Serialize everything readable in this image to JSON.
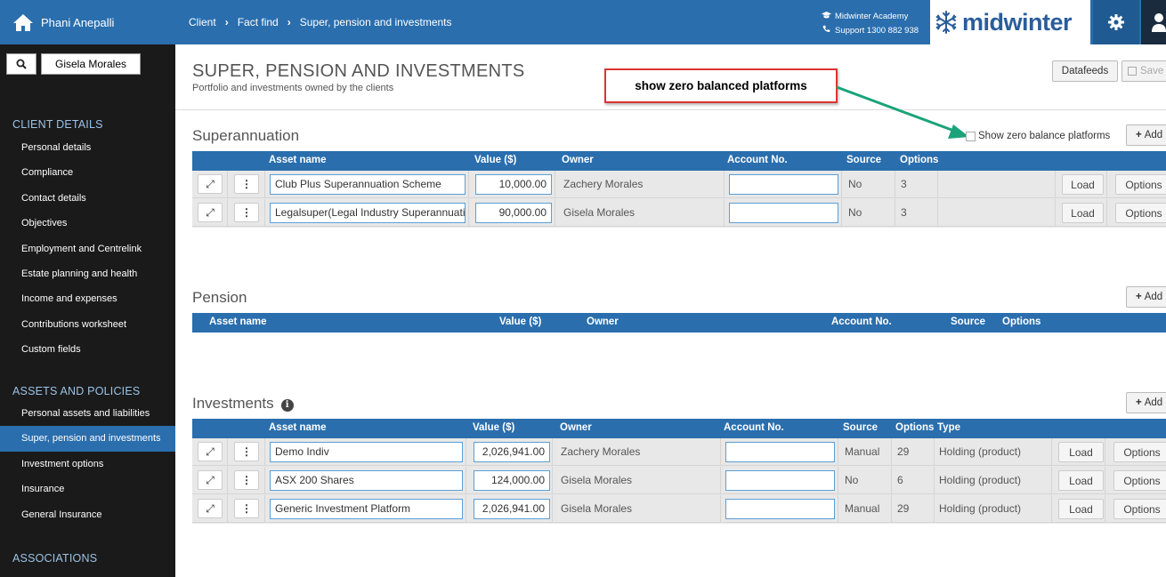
{
  "user": {
    "name": "Phani Anepalli"
  },
  "client_search": {
    "value": "Gisela Morales"
  },
  "sidebar": {
    "sections": [
      {
        "title": "CLIENT DETAILS",
        "items": [
          {
            "label": "Personal details"
          },
          {
            "label": "Compliance"
          },
          {
            "label": "Contact details"
          },
          {
            "label": "Objectives"
          },
          {
            "label": "Employment and Centrelink"
          },
          {
            "label": "Estate planning and health"
          },
          {
            "label": "Income and expenses"
          },
          {
            "label": "Contributions worksheet"
          },
          {
            "label": "Custom fields"
          }
        ]
      },
      {
        "title": "ASSETS AND POLICIES",
        "items": [
          {
            "label": "Personal assets and liabilities"
          },
          {
            "label": "Super, pension and investments",
            "active": true
          },
          {
            "label": "Investment options"
          },
          {
            "label": "Insurance"
          },
          {
            "label": "General Insurance"
          }
        ]
      },
      {
        "title": "ASSOCIATIONS",
        "items": []
      }
    ]
  },
  "breadcrumb": [
    "Client",
    "Fact find",
    "Super, pension and investments"
  ],
  "header_links": {
    "academy": "Midwinter Academy",
    "support": "Support 1300 882 938"
  },
  "logo_text": "midwinter",
  "page": {
    "title": "SUPER, PENSION AND INVESTMENTS",
    "subtitle": "Portfolio and investments owned by the clients",
    "datafeeds_label": "Datafeeds",
    "save_label": "Save"
  },
  "annotation": {
    "callout_text": "show zero balanced platforms",
    "arrow_color": "#1aa37a",
    "border_color": "#dd3333"
  },
  "superannuation": {
    "title": "Superannuation",
    "show_zero_label": "Show zero balance platforms",
    "add_label": "Add",
    "columns": [
      "Asset name",
      "Value ($)",
      "Owner",
      "Account No.",
      "Source",
      "Options"
    ],
    "rows": [
      {
        "asset": "Club Plus Superannuation Scheme",
        "value": "10,000.00",
        "owner": "Zachery Morales",
        "account": "",
        "source": "No",
        "options": "3",
        "load": "Load",
        "options_btn": "Options"
      },
      {
        "asset": "Legalsuper(Legal Industry Superannuation",
        "value": "90,000.00",
        "owner": "Gisela Morales",
        "account": "",
        "source": "No",
        "options": "3",
        "load": "Load",
        "options_btn": "Options"
      }
    ]
  },
  "pension": {
    "title": "Pension",
    "add_label": "Add",
    "columns": [
      "Asset name",
      "Value ($)",
      "Owner",
      "Account No.",
      "Source",
      "Options"
    ],
    "rows": []
  },
  "investments": {
    "title": "Investments",
    "add_label": "Add",
    "columns": [
      "Asset name",
      "Value ($)",
      "Owner",
      "Account No.",
      "Source",
      "Options",
      "Type"
    ],
    "rows": [
      {
        "asset": "Demo Indiv",
        "value": "2,026,941.00",
        "owner": "Zachery Morales",
        "account": "",
        "source": "Manual",
        "options": "29",
        "type": "Holding (product)",
        "load": "Load",
        "options_btn": "Options"
      },
      {
        "asset": "ASX 200 Shares",
        "value": "124,000.00",
        "owner": "Gisela Morales",
        "account": "",
        "source": "No",
        "options": "6",
        "type": "Holding (product)",
        "load": "Load",
        "options_btn": "Options"
      },
      {
        "asset": "Generic Investment Platform",
        "value": "2,026,941.00",
        "owner": "Gisela Morales",
        "account": "",
        "source": "Manual",
        "options": "29",
        "type": "Holding (product)",
        "load": "Load",
        "options_btn": "Options"
      }
    ]
  }
}
